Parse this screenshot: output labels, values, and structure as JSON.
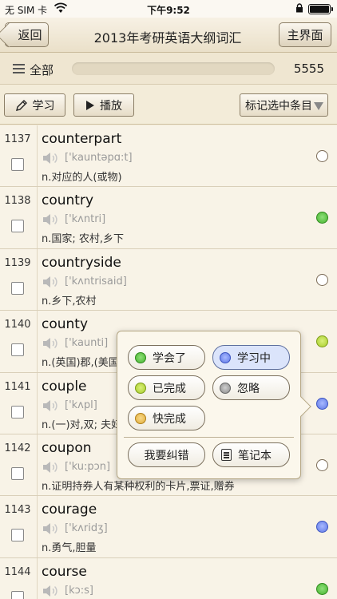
{
  "status_bar": {
    "carrier": "无 SIM 卡",
    "time": "下午9:52"
  },
  "nav": {
    "back_label": "返回",
    "title": "2013年考研英语大纲词汇",
    "home_label": "主界面"
  },
  "progress_row": {
    "category_label": "全部",
    "count": "5555"
  },
  "toolbar": {
    "study_label": "学习",
    "play_label": "播放",
    "mark_label": "标记选中条目"
  },
  "words": [
    {
      "num": "1137",
      "word": "counterpart",
      "phonetic": "['kauntəpɑ:t]",
      "definition": "n.对应的人(或物)",
      "status": "empty"
    },
    {
      "num": "1138",
      "word": "country",
      "phonetic": "['kʌntri]",
      "definition": "n.国家; 农村,乡下",
      "status": "green"
    },
    {
      "num": "1139",
      "word": "countryside",
      "phonetic": "['kʌntrisaid]",
      "definition": "n.乡下,农村",
      "status": "empty"
    },
    {
      "num": "1140",
      "word": "county",
      "phonetic": "['kaunti]",
      "definition": "n.(英国)郡,(美国)县",
      "status": "lime"
    },
    {
      "num": "1141",
      "word": "couple",
      "phonetic": "['kʌpl]",
      "definition": "n.(一)对,双; 夫妇",
      "status": "blue"
    },
    {
      "num": "1142",
      "word": "coupon",
      "phonetic": "['ku:pɔn]",
      "definition": "n.证明持券人有某种权利的卡片,票证,赠券",
      "status": "empty"
    },
    {
      "num": "1143",
      "word": "courage",
      "phonetic": "['kʌridʒ]",
      "definition": "n.勇气,胆量",
      "status": "blue"
    },
    {
      "num": "1144",
      "word": "course",
      "phonetic": "[kɔ:s]",
      "definition": "",
      "status": "green"
    }
  ],
  "popup": {
    "learned": "学会了",
    "learning": "学习中",
    "done": "已完成",
    "ignore": "忽略",
    "almost": "快完成",
    "correct": "我要纠错",
    "notebook": "笔记本"
  }
}
